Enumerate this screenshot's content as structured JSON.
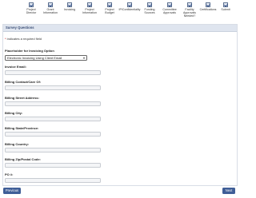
{
  "steps": [
    {
      "label": "Project\nDirector"
    },
    {
      "label": "Grant\nInformation"
    },
    {
      "label": "Invoicing"
    },
    {
      "label": "Project\nInformation"
    },
    {
      "label": "Project\nBudget"
    },
    {
      "label": "IP/Confidentiality"
    },
    {
      "label": "Funding\nSources"
    },
    {
      "label": "Committee\nApprovals"
    },
    {
      "label": "Facility\nApprovals\nNeeded?"
    },
    {
      "label": "Certifications"
    },
    {
      "label": "Submit"
    }
  ],
  "panel": {
    "title": "Survey Questions"
  },
  "required_note": "* indicates a required field",
  "required_star": "*",
  "invoicing_option": {
    "label": "Placeholder for Invoicing Option",
    "selected": "Electronic Invoicing Using Client Email"
  },
  "fields": [
    {
      "label": "Invoice Email:",
      "value": ""
    },
    {
      "label": "Billing Contact/Care Of:",
      "value": ""
    },
    {
      "label": "Billing Street Address:",
      "value": ""
    },
    {
      "label": "Billing City:",
      "value": ""
    },
    {
      "label": "Billing State/Province:",
      "value": ""
    },
    {
      "label": "Billing Country:",
      "value": ""
    },
    {
      "label": "Billing Zip/Postal Code:",
      "value": ""
    },
    {
      "label": "PO #:",
      "value": ""
    }
  ],
  "nav": {
    "previous": "Previous",
    "next": "Next"
  },
  "colors": {
    "accent": "#3f5e97",
    "panel_header": "#dfe5ef",
    "panel_title": "#3b4f77"
  }
}
